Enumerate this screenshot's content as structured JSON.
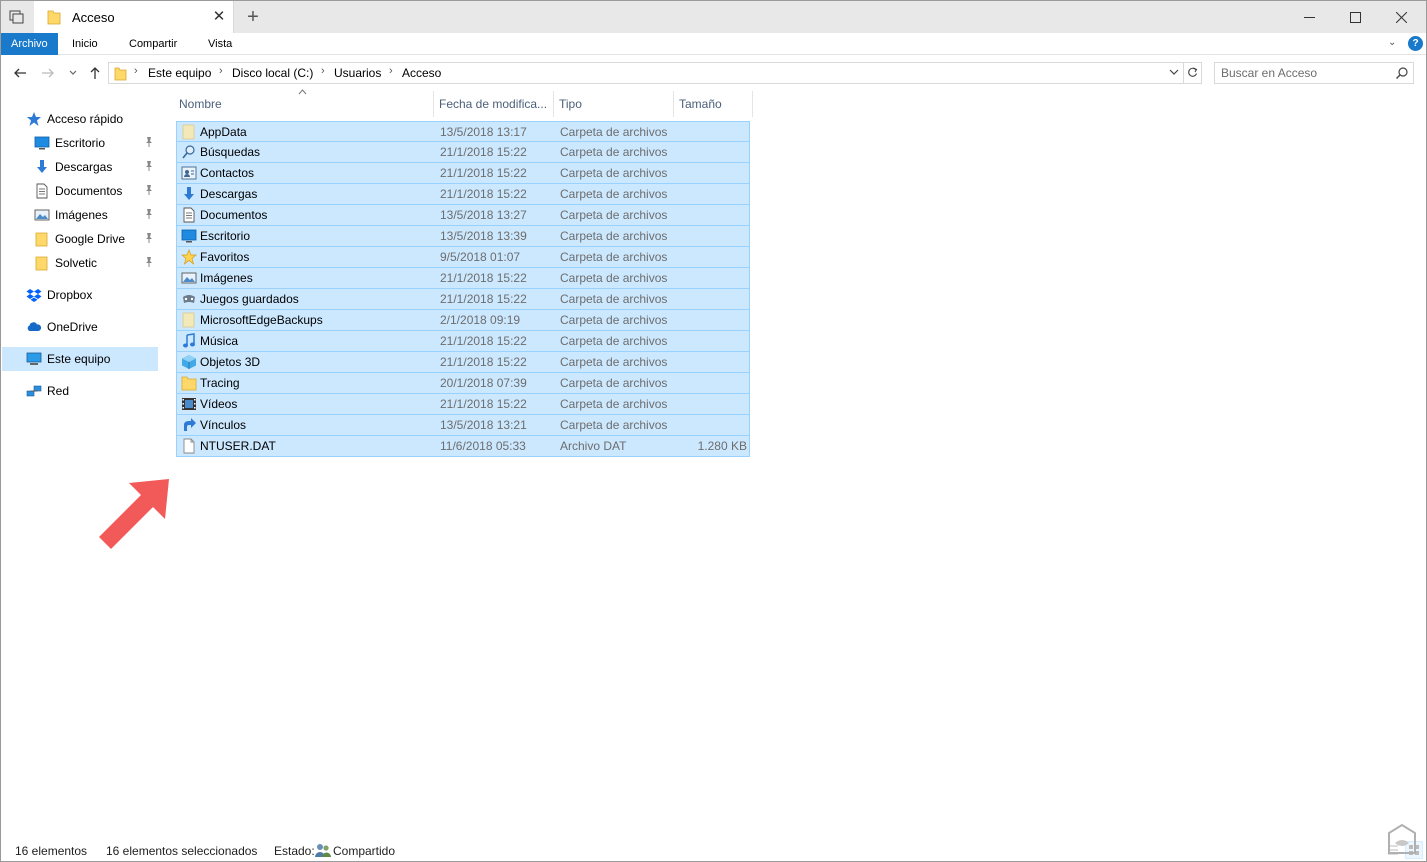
{
  "window": {
    "tab_title": "Acceso",
    "new_tab_glyph": "+",
    "close_tab_glyph": "✕"
  },
  "ribbon": {
    "tabs": [
      "Archivo",
      "Inicio",
      "Compartir",
      "Vista"
    ],
    "active_tab": "Archivo",
    "accent_color": "#1979ca",
    "help_glyph": "?"
  },
  "address": {
    "breadcrumbs": [
      "Este equipo",
      "Disco local (C:)",
      "Usuarios",
      "Acceso"
    ]
  },
  "search": {
    "placeholder": "Buscar en Acceso"
  },
  "sidebar": {
    "quick_access": {
      "label": "Acceso rápido",
      "icon": "star-icon"
    },
    "pinned": [
      {
        "label": "Escritorio",
        "icon": "desktop-icon"
      },
      {
        "label": "Descargas",
        "icon": "download-icon"
      },
      {
        "label": "Documentos",
        "icon": "document-icon"
      },
      {
        "label": "Imágenes",
        "icon": "pictures-icon"
      },
      {
        "label": "Google Drive",
        "icon": "folder-icon"
      },
      {
        "label": "Solvetic",
        "icon": "folder-icon"
      }
    ],
    "locations": [
      {
        "label": "Dropbox",
        "icon": "dropbox-icon"
      },
      {
        "label": "OneDrive",
        "icon": "cloud-icon"
      },
      {
        "label": "Este equipo",
        "icon": "computer-icon",
        "selected": true
      },
      {
        "label": "Red",
        "icon": "network-icon"
      }
    ]
  },
  "columns": {
    "name": "Nombre",
    "date": "Fecha de modifica...",
    "type": "Tipo",
    "size": "Tamaño"
  },
  "files": [
    {
      "name": "AppData",
      "date": "13/5/2018 13:17",
      "type": "Carpeta de archivos",
      "size": "",
      "icon": "folder-faded-icon"
    },
    {
      "name": "Búsquedas",
      "date": "21/1/2018 15:22",
      "type": "Carpeta de archivos",
      "size": "",
      "icon": "search-folder-icon"
    },
    {
      "name": "Contactos",
      "date": "21/1/2018 15:22",
      "type": "Carpeta de archivos",
      "size": "",
      "icon": "contacts-icon"
    },
    {
      "name": "Descargas",
      "date": "21/1/2018 15:22",
      "type": "Carpeta de archivos",
      "size": "",
      "icon": "download-icon"
    },
    {
      "name": "Documentos",
      "date": "13/5/2018 13:27",
      "type": "Carpeta de archivos",
      "size": "",
      "icon": "document-icon"
    },
    {
      "name": "Escritorio",
      "date": "13/5/2018 13:39",
      "type": "Carpeta de archivos",
      "size": "",
      "icon": "desktop-icon"
    },
    {
      "name": "Favoritos",
      "date": "9/5/2018 01:07",
      "type": "Carpeta de archivos",
      "size": "",
      "icon": "star-icon"
    },
    {
      "name": "Imágenes",
      "date": "21/1/2018 15:22",
      "type": "Carpeta de archivos",
      "size": "",
      "icon": "pictures-icon"
    },
    {
      "name": "Juegos guardados",
      "date": "21/1/2018 15:22",
      "type": "Carpeta de archivos",
      "size": "",
      "icon": "games-icon"
    },
    {
      "name": "MicrosoftEdgeBackups",
      "date": "2/1/2018 09:19",
      "type": "Carpeta de archivos",
      "size": "",
      "icon": "folder-faded-icon"
    },
    {
      "name": "Música",
      "date": "21/1/2018 15:22",
      "type": "Carpeta de archivos",
      "size": "",
      "icon": "music-icon"
    },
    {
      "name": "Objetos 3D",
      "date": "21/1/2018 15:22",
      "type": "Carpeta de archivos",
      "size": "",
      "icon": "objects-3d-icon"
    },
    {
      "name": "Tracing",
      "date": "20/1/2018 07:39",
      "type": "Carpeta de archivos",
      "size": "",
      "icon": "folder-icon"
    },
    {
      "name": "Vídeos",
      "date": "21/1/2018 15:22",
      "type": "Carpeta de archivos",
      "size": "",
      "icon": "video-icon"
    },
    {
      "name": "Vínculos",
      "date": "13/5/2018 13:21",
      "type": "Carpeta de archivos",
      "size": "",
      "icon": "link-icon"
    },
    {
      "name": "NTUSER.DAT",
      "date": "11/6/2018 05:33",
      "type": "Archivo DAT",
      "size": "1.280 KB",
      "icon": "file-icon"
    }
  ],
  "status": {
    "count": "16 elementos",
    "selected": "16 elementos seleccionados",
    "state_label": "Estado:",
    "state_value": "Compartido"
  },
  "colors": {
    "selection_bg": "#cce8ff",
    "selection_border": "#99d1ff",
    "annotation_arrow": "#f25a5a",
    "folder_yellow": "#ffd86a"
  }
}
